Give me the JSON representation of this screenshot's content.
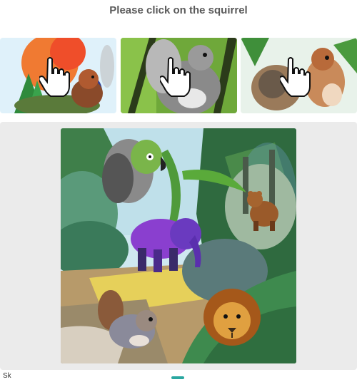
{
  "challenge": {
    "prompt": "Please click on the squirrel"
  },
  "thumbnails": [
    {
      "icon": "pointer-hand-icon",
      "subject": "squirrel-thumbnail"
    },
    {
      "icon": "pointer-hand-icon",
      "subject": "squirrel-thumbnail"
    },
    {
      "icon": "pointer-hand-icon",
      "subject": "squirrel-thumbnail"
    }
  ],
  "footer": {
    "text": "Sk"
  },
  "colors": {
    "panel": "#ebebeb",
    "prompt_text": "#5a5a5a",
    "accent": "#2aa7a0"
  }
}
